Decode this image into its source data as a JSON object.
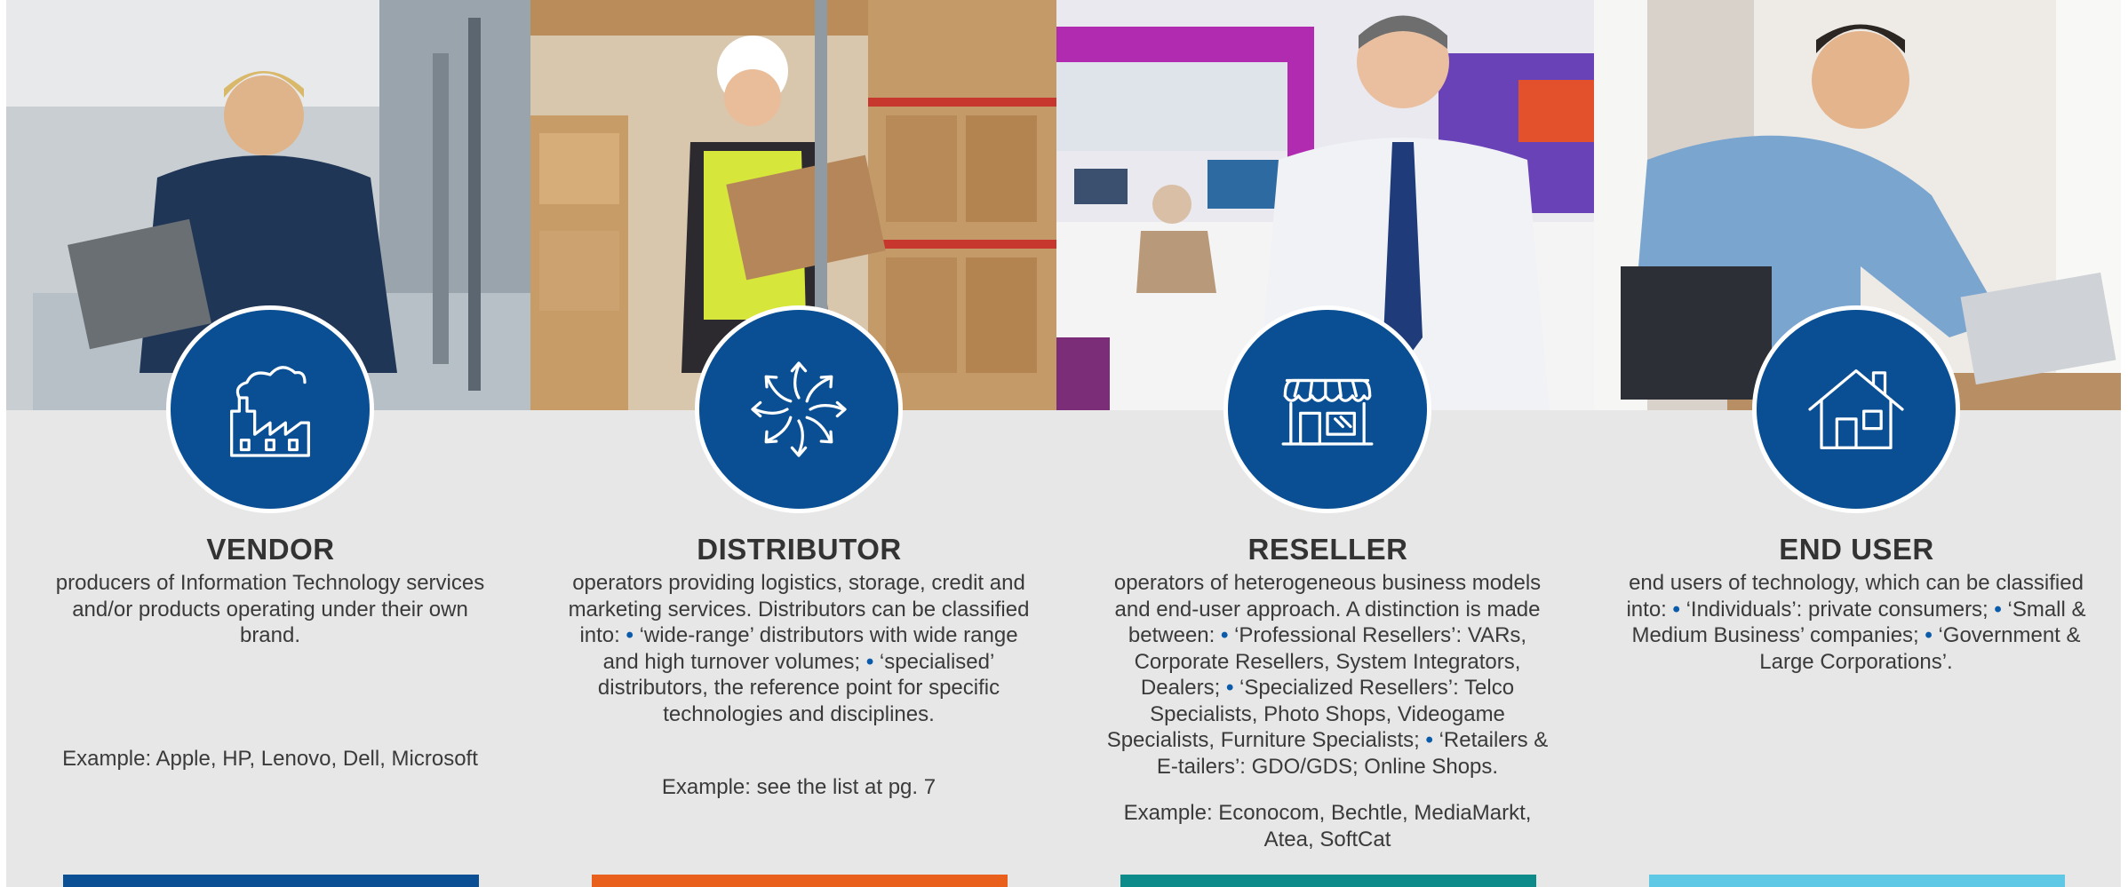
{
  "colors": {
    "background": "#e7e7e7",
    "badge": "#0a4f93",
    "bullet": "#0a5cab",
    "bars": [
      "#0a4f93",
      "#e8601c",
      "#0d8a8a",
      "#5ec8e5"
    ]
  },
  "columns": [
    {
      "icon": "factory-icon",
      "title": "VENDOR",
      "description": "producers of Information Technology services and/or products operating under their own brand.",
      "example": "Example: Apple, HP, Lenovo, Dell, Microsoft"
    },
    {
      "icon": "distribution-arrows-icon",
      "title": "DISTRIBUTOR",
      "desc_parts": [
        "operators providing logistics, storage, credit and marketing services. Distributors can be classified into: ",
        "• ",
        "‘wide-range’ distributors with wide range and high turnover volumes; ",
        "• ",
        "‘specialised’ distributors, the reference point for specific technologies and disciplines."
      ],
      "example": "Example: see the list at pg. 7"
    },
    {
      "icon": "shop-icon",
      "title": "RESELLER",
      "desc_parts": [
        "operators of heterogeneous business models and end-user approach. A distinction is made between: ",
        "• ",
        "‘Professional Resellers’: VARs, Corporate Resellers, System Integrators, Dealers; ",
        "• ",
        "‘Specialized Resellers’: Telco Specialists, Photo Shops, Videogame Specialists, Furniture Specialists; ",
        "• ",
        "‘Retailers & E-tailers’: GDO/GDS; Online Shops."
      ],
      "example": "Example: Econocom, Bechtle, MediaMarkt, Atea, SoftCat"
    },
    {
      "icon": "house-icon",
      "title": "END USER",
      "desc_parts": [
        "end users of technology, which can be classified into: ",
        "• ",
        "‘Individuals’: private consumers; ",
        "• ",
        "‘Small & Medium Business’ companies; ",
        "• ",
        "‘Government & Large Corporations’."
      ]
    }
  ]
}
